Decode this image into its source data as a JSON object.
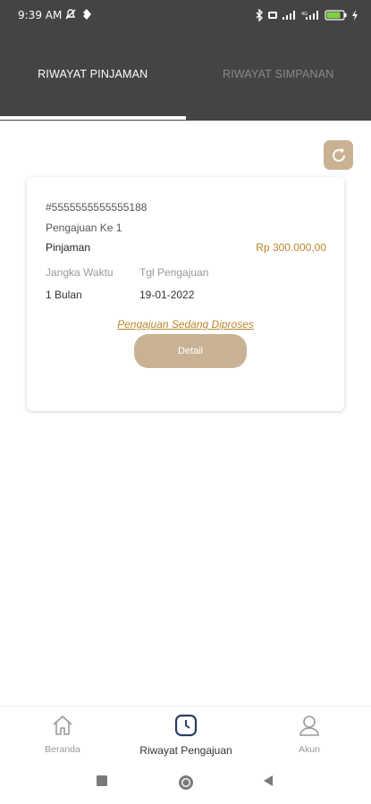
{
  "status_bar": {
    "time": "9:39 AM",
    "battery_level": "76"
  },
  "tabs": [
    {
      "label": "RIWAYAT PINJAMAN",
      "active": true
    },
    {
      "label": "RIWAYAT SIMPANAN",
      "active": false
    }
  ],
  "card": {
    "id": "#5555555555555188",
    "submission": "Pengajuan Ke 1",
    "type": "Pinjaman",
    "amount": "Rp 300.000,00",
    "term_label": "Jangka Waktu",
    "date_label": "Tgl Pengajuan",
    "term_value": "1 Bulan",
    "date_value": "19-01-2022",
    "status": "Pengajuan Sedang Diproses",
    "detail_button": "Detail"
  },
  "bottom_nav": [
    {
      "label": "Beranda",
      "icon": "home-icon",
      "active": false
    },
    {
      "label": "Riwayat Pengajuan",
      "icon": "history-icon",
      "active": true
    },
    {
      "label": "Akun",
      "icon": "user-icon",
      "active": false
    }
  ],
  "colors": {
    "header": "#444444",
    "accent": "#c9b293",
    "amount": "#b8862e"
  }
}
